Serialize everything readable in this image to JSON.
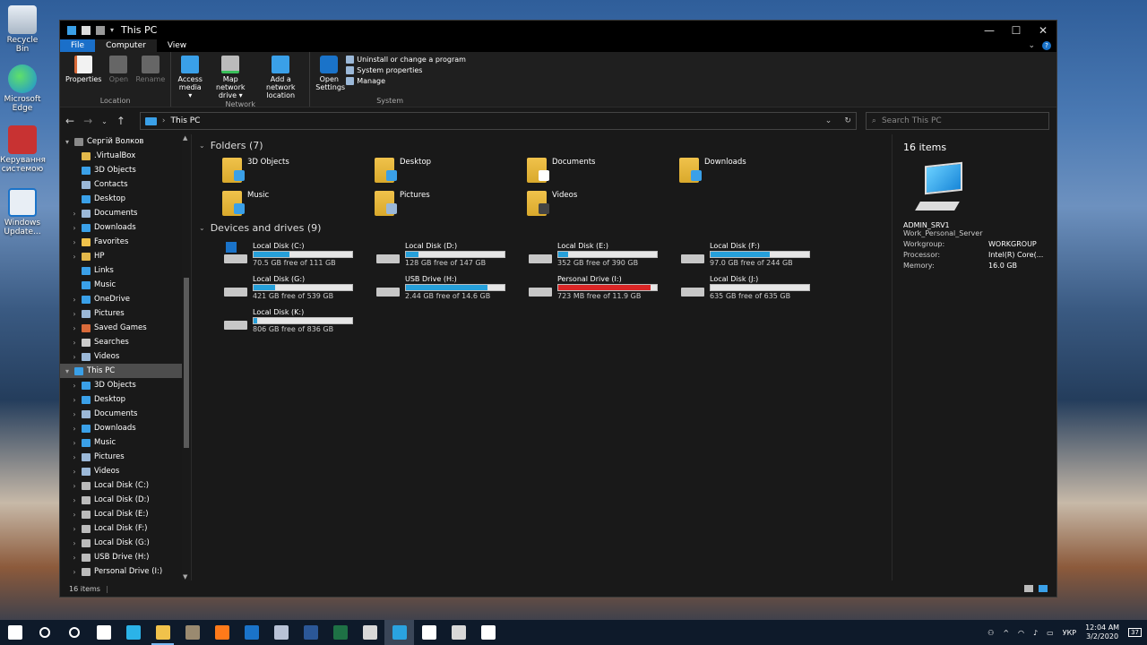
{
  "desktop": {
    "icons": [
      {
        "label": "Recycle Bin"
      },
      {
        "label": "Microsoft Edge"
      },
      {
        "label": "Керування системою"
      },
      {
        "label": "Windows Update..."
      }
    ]
  },
  "window": {
    "title": "This PC",
    "tabs": {
      "file": "File",
      "computer": "Computer",
      "view": "View"
    },
    "ribbon": {
      "location": {
        "label": "Location",
        "properties": "Properties",
        "open": "Open",
        "rename": "Rename"
      },
      "network": {
        "label": "Network",
        "access_media": "Access media ▾",
        "map_drive": "Map network drive ▾",
        "add_location": "Add a network location"
      },
      "system": {
        "label": "System",
        "open_settings": "Open Settings",
        "uninstall": "Uninstall or change a program",
        "sys_props": "System properties",
        "manage": "Manage"
      }
    },
    "address": {
      "path": "This PC",
      "search_placeholder": "Search This PC"
    },
    "nav": [
      {
        "label": "Сергій Волков",
        "indent": 0,
        "chev": "▾",
        "color": "#8a8a8a"
      },
      {
        "label": ".VirtualBox",
        "indent": 1,
        "chev": "",
        "color": "#e3b84a"
      },
      {
        "label": "3D Objects",
        "indent": 1,
        "chev": "",
        "color": "#3aa0e8"
      },
      {
        "label": "Contacts",
        "indent": 1,
        "chev": "",
        "color": "#9bb8d8"
      },
      {
        "label": "Desktop",
        "indent": 1,
        "chev": "",
        "color": "#3aa0e8"
      },
      {
        "label": "Documents",
        "indent": 1,
        "chev": "›",
        "color": "#9bb8d8"
      },
      {
        "label": "Downloads",
        "indent": 1,
        "chev": "›",
        "color": "#3aa0e8"
      },
      {
        "label": "Favorites",
        "indent": 1,
        "chev": "›",
        "color": "#f0c24b"
      },
      {
        "label": "HP",
        "indent": 1,
        "chev": "›",
        "color": "#e3b84a"
      },
      {
        "label": "Links",
        "indent": 1,
        "chev": "",
        "color": "#3aa0e8"
      },
      {
        "label": "Music",
        "indent": 1,
        "chev": "",
        "color": "#3aa0e8"
      },
      {
        "label": "OneDrive",
        "indent": 1,
        "chev": "›",
        "color": "#3aa0e8"
      },
      {
        "label": "Pictures",
        "indent": 1,
        "chev": "›",
        "color": "#9bb8d8"
      },
      {
        "label": "Saved Games",
        "indent": 1,
        "chev": "›",
        "color": "#d86a3a"
      },
      {
        "label": "Searches",
        "indent": 1,
        "chev": "›",
        "color": "#cccccc"
      },
      {
        "label": "Videos",
        "indent": 1,
        "chev": "›",
        "color": "#9bb8d8"
      },
      {
        "label": "This PC",
        "indent": 0,
        "chev": "▾",
        "color": "#3aa0e8",
        "selected": true
      },
      {
        "label": "3D Objects",
        "indent": 1,
        "chev": "›",
        "color": "#3aa0e8"
      },
      {
        "label": "Desktop",
        "indent": 1,
        "chev": "›",
        "color": "#3aa0e8"
      },
      {
        "label": "Documents",
        "indent": 1,
        "chev": "›",
        "color": "#9bb8d8"
      },
      {
        "label": "Downloads",
        "indent": 1,
        "chev": "›",
        "color": "#3aa0e8"
      },
      {
        "label": "Music",
        "indent": 1,
        "chev": "›",
        "color": "#3aa0e8"
      },
      {
        "label": "Pictures",
        "indent": 1,
        "chev": "›",
        "color": "#9bb8d8"
      },
      {
        "label": "Videos",
        "indent": 1,
        "chev": "›",
        "color": "#9bb8d8"
      },
      {
        "label": "Local Disk (C:)",
        "indent": 1,
        "chev": "›",
        "color": "#bbbbbb"
      },
      {
        "label": "Local Disk (D:)",
        "indent": 1,
        "chev": "›",
        "color": "#bbbbbb"
      },
      {
        "label": "Local Disk (E:)",
        "indent": 1,
        "chev": "›",
        "color": "#bbbbbb"
      },
      {
        "label": "Local Disk (F:)",
        "indent": 1,
        "chev": "›",
        "color": "#bbbbbb"
      },
      {
        "label": "Local Disk (G:)",
        "indent": 1,
        "chev": "›",
        "color": "#bbbbbb"
      },
      {
        "label": "USB Drive (H:)",
        "indent": 1,
        "chev": "›",
        "color": "#bbbbbb"
      },
      {
        "label": "Personal Drive (I:)",
        "indent": 1,
        "chev": "›",
        "color": "#bbbbbb"
      },
      {
        "label": "Local Disk (J:)",
        "indent": 1,
        "chev": "›",
        "color": "#bbbbbb"
      }
    ],
    "folders_header": {
      "title": "Folders",
      "count": "(7)"
    },
    "folders": [
      {
        "name": "3D Objects",
        "badge": "#3aa0e8"
      },
      {
        "name": "Desktop",
        "badge": "#3aa0e8"
      },
      {
        "name": "Documents",
        "badge": "#ffffff"
      },
      {
        "name": "Downloads",
        "badge": "#3aa0e8"
      },
      {
        "name": "Music",
        "badge": "#3aa0e8"
      },
      {
        "name": "Pictures",
        "badge": "#9bb8d8"
      },
      {
        "name": "Videos",
        "badge": "#444444"
      }
    ],
    "drives_header": {
      "title": "Devices and drives",
      "count": "(9)"
    },
    "drives": [
      {
        "name": "Local Disk (C:)",
        "free": "70.5 GB free of 111 GB",
        "used_fraction": 0.36,
        "warn": false,
        "os": true
      },
      {
        "name": "Local Disk (D:)",
        "free": "128 GB free of 147 GB",
        "used_fraction": 0.13,
        "warn": false
      },
      {
        "name": "Local Disk (E:)",
        "free": "352 GB free of 390 GB",
        "used_fraction": 0.1,
        "warn": false
      },
      {
        "name": "Local Disk (F:)",
        "free": "97.0 GB free of 244 GB",
        "used_fraction": 0.6,
        "warn": false
      },
      {
        "name": "Local Disk (G:)",
        "free": "421 GB free of 539 GB",
        "used_fraction": 0.22,
        "warn": false
      },
      {
        "name": "USB Drive (H:)",
        "free": "2.44 GB free of 14.6 GB",
        "used_fraction": 0.83,
        "warn": false
      },
      {
        "name": "Personal Drive (I:)",
        "free": "723 MB free of 11.9 GB",
        "used_fraction": 0.94,
        "warn": true
      },
      {
        "name": "Local Disk (J:)",
        "free": "635 GB free of 635 GB",
        "used_fraction": 0.0,
        "warn": false
      },
      {
        "name": "Local Disk (K:)",
        "free": "806 GB free of 836 GB",
        "used_fraction": 0.04,
        "warn": false
      }
    ],
    "details": {
      "count": "16 items",
      "name": "ADMIN_SRV1",
      "desc": "Work_Personal_Server",
      "rows": [
        {
          "k": "Workgroup:",
          "v": "WORKGROUP"
        },
        {
          "k": "Processor:",
          "v": "Intel(R) Core(..."
        },
        {
          "k": "Memory:",
          "v": "16.0 GB"
        }
      ]
    },
    "status": "16 items"
  },
  "taskbar": {
    "apps": [
      {
        "name": "start-icon",
        "color": "#ffffff"
      },
      {
        "name": "search-icon",
        "color": "#ffffff"
      },
      {
        "name": "cortana-icon",
        "color": "#ffffff"
      },
      {
        "name": "task-view-icon",
        "color": "#ffffff"
      },
      {
        "name": "edge-icon",
        "color": "#2bb3e8"
      },
      {
        "name": "file-explorer-icon",
        "color": "#f0c24b",
        "active": true
      },
      {
        "name": "media-player-icon",
        "color": "#9a8a70"
      },
      {
        "name": "firefox-icon",
        "color": "#ff7a1a"
      },
      {
        "name": "outlook-icon",
        "color": "#1a73c9"
      },
      {
        "name": "cloud-app-icon",
        "color": "#b8c2d6"
      },
      {
        "name": "word-icon",
        "color": "#2b5797"
      },
      {
        "name": "excel-icon",
        "color": "#1e7145"
      },
      {
        "name": "terminal-icon",
        "color": "#d8d8d8"
      },
      {
        "name": "telegram-icon",
        "color": "#2aa3e0",
        "highlight": true
      },
      {
        "name": "pointer-app-icon",
        "color": "#ffffff"
      },
      {
        "name": "calculator-icon",
        "color": "#d8d8d8"
      },
      {
        "name": "video-editor-icon",
        "color": "#ffffff"
      }
    ],
    "lang": "УКР",
    "time": "12:04 AM",
    "date": "3/2/2020",
    "notifications": "37"
  }
}
